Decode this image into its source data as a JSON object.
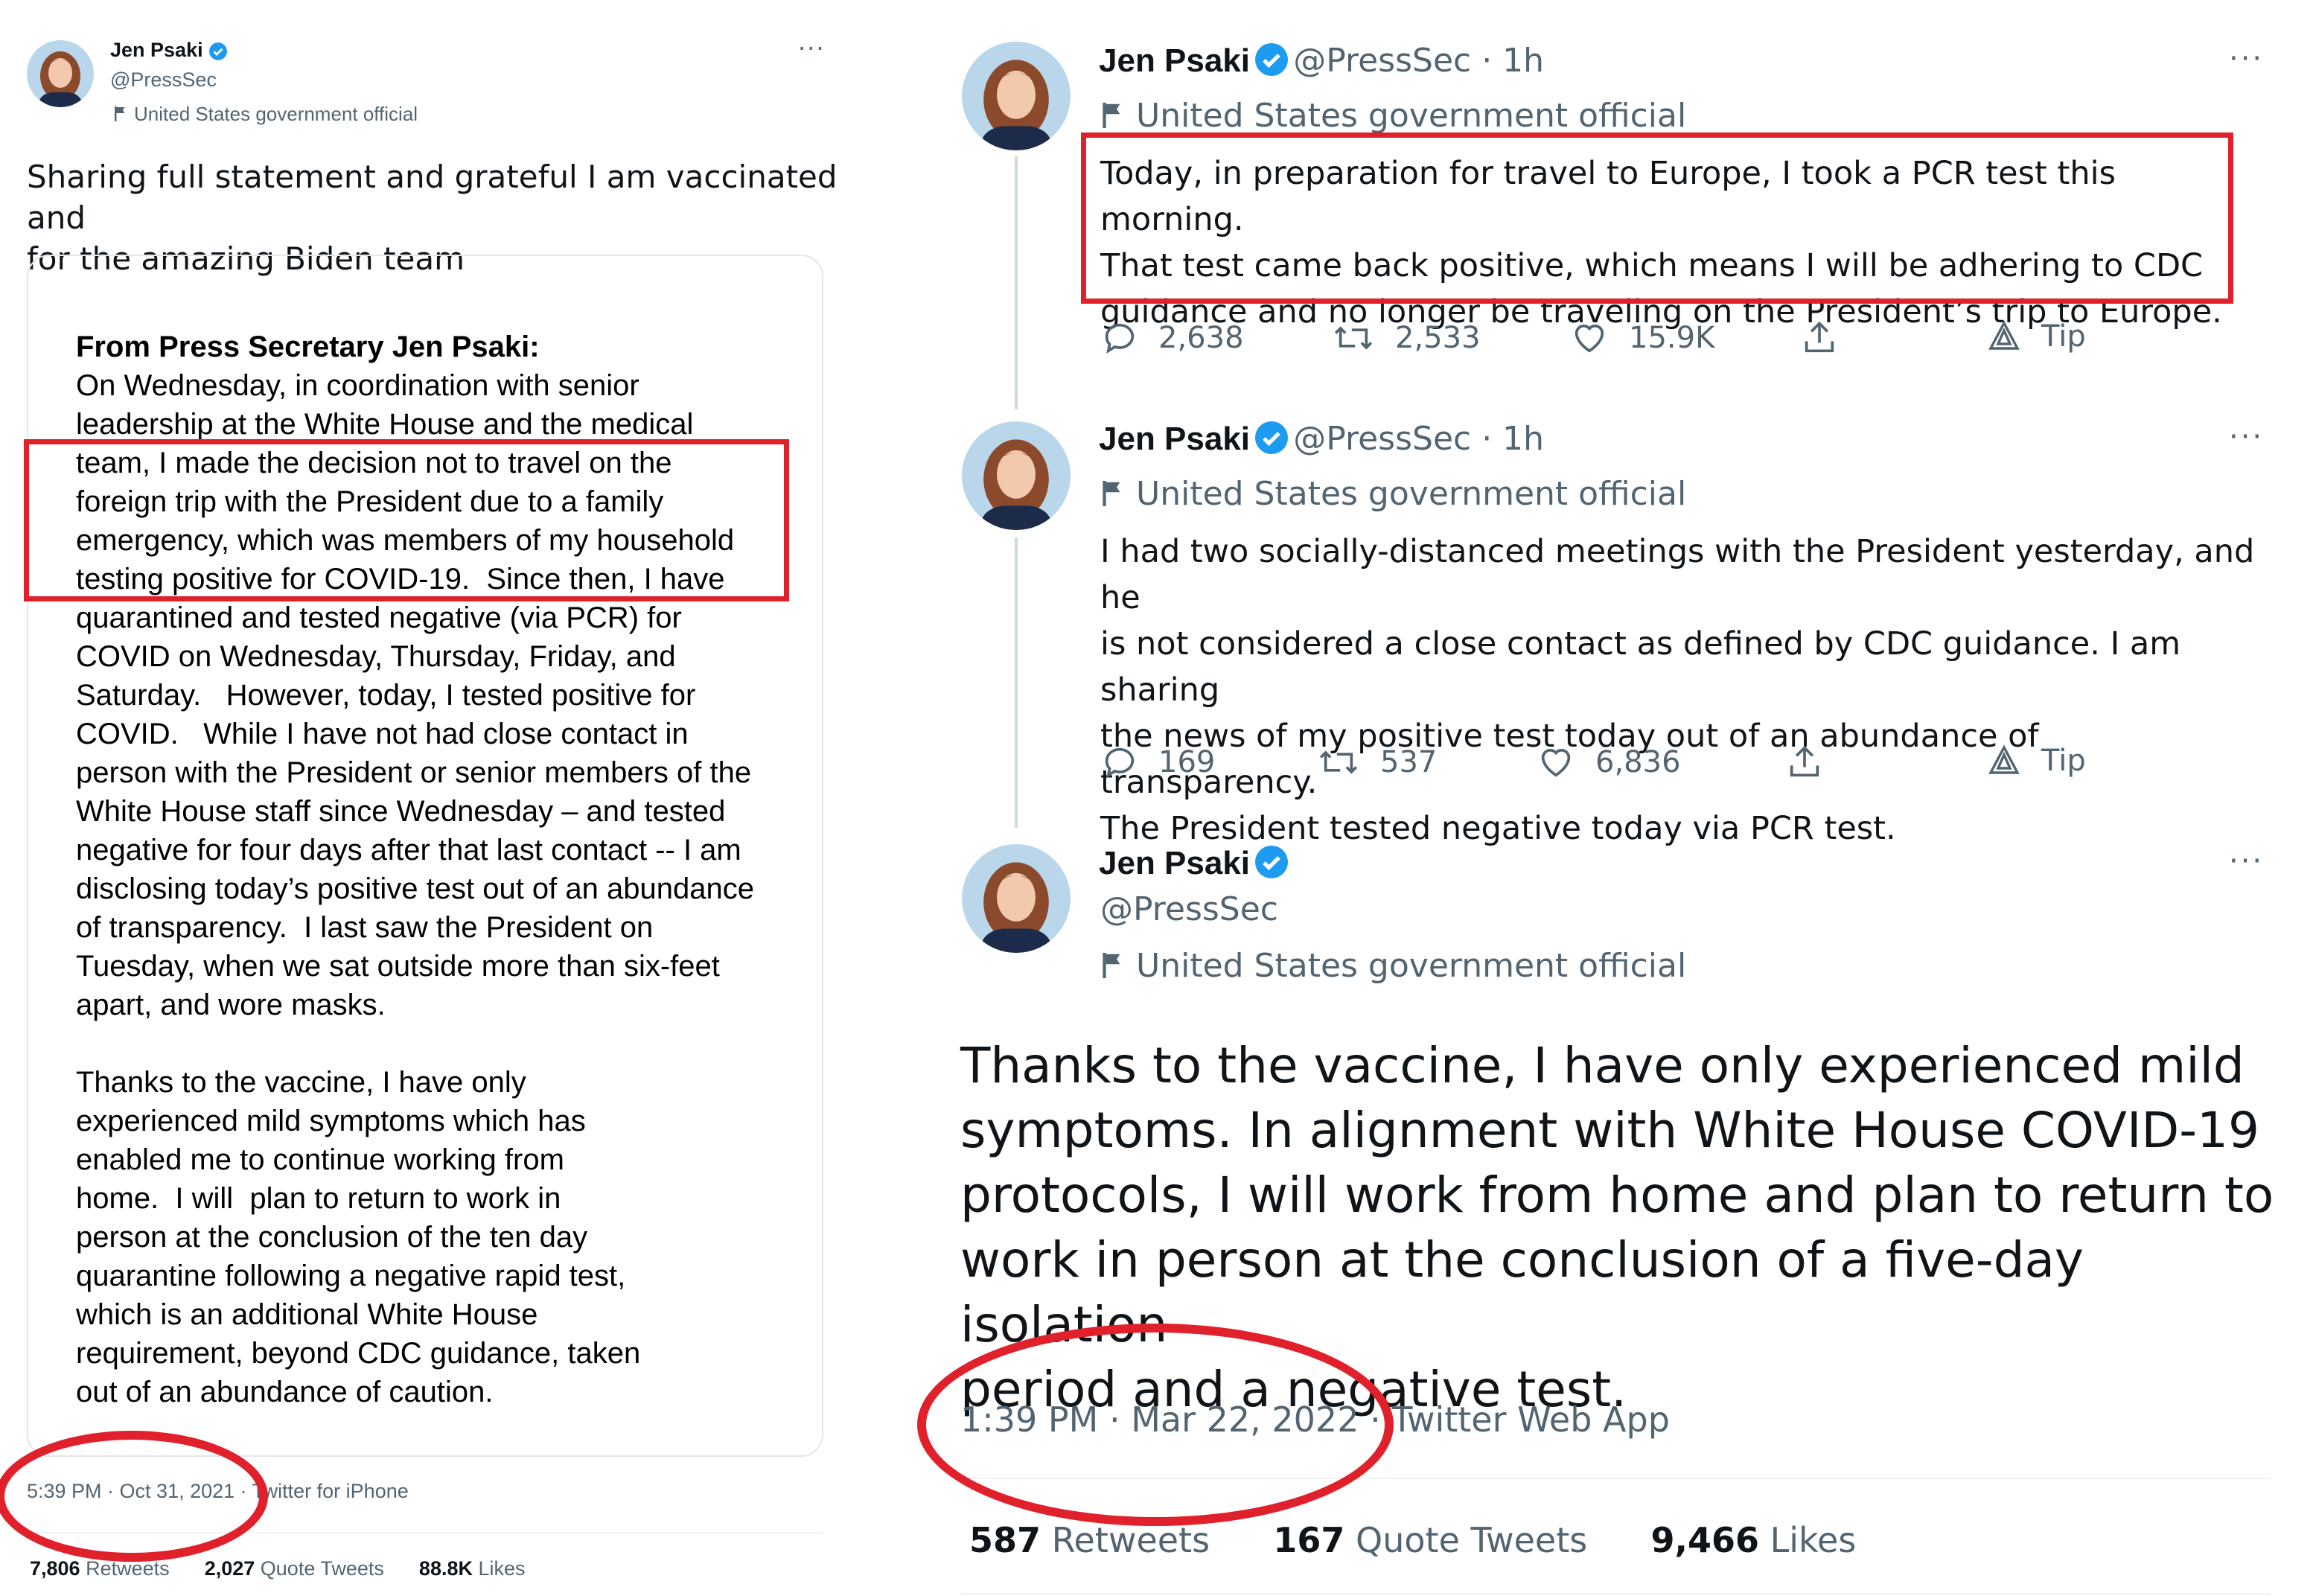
{
  "colors": {
    "verified_blue": "#1d9bf0",
    "annotation_red": "#e0202a",
    "muted": "#536471"
  },
  "left_tweet": {
    "author_name": "Jen Psaki",
    "handle": "@PressSec",
    "gov_label": "United States government official",
    "more_label": "···",
    "text_lines": [
      "Sharing full statement and grateful I am vaccinated and",
      "for the amazing Biden team"
    ],
    "statement": {
      "title": "From Press Secretary Jen Psaki:",
      "lines": [
        "On Wednesday, in coordination with senior",
        "leadership at the White House and the medical",
        "team, I made the decision not to travel on the",
        "foreign trip with the President due to a family",
        "emergency, which was members of my household",
        "testing positive for COVID-19.  Since then, I have",
        "quarantined and tested negative (via PCR) for",
        "COVID on Wednesday, Thursday, Friday, and",
        "Saturday.   However, today, I tested positive for",
        "COVID.   While I have not had close contact in",
        "person with the President or senior members of the",
        "White House staff since Wednesday – and tested",
        "negative for four days after that last contact -- I am",
        "disclosing today’s positive test out of an abundance",
        "of transparency.  I last saw the President on",
        "Tuesday, when we sat outside more than six-feet",
        "apart, and wore masks.",
        "",
        "Thanks to the vaccine, I have only",
        "experienced mild symptoms which has",
        "enabled me to continue working from",
        "home.  I will  plan to return to work in",
        "person at the conclusion of the ten day",
        "quarantine following a negative rapid test,",
        "which is an additional White House",
        "requirement, beyond CDC guidance, taken",
        "out of an abundance of caution."
      ]
    },
    "timestamp": "5:39 PM · Oct 31, 2021 · Twitter for iPhone",
    "stats": {
      "retweets": "7,806",
      "retweets_label": "Retweets",
      "quotes": "2,027",
      "quotes_label": "Quote Tweets",
      "likes": "88.8K",
      "likes_label": "Likes"
    }
  },
  "right_thread": {
    "tweets": [
      {
        "author_name": "Jen Psaki",
        "handle_time": "@PressSec · 1h",
        "gov_label": "United States government official",
        "body_lines": [
          "Today, in preparation for travel to Europe, I took a PCR test this morning.",
          "That test came back positive, which means I will be adhering to CDC",
          "guidance and no longer be traveling on the President’s trip to Europe."
        ],
        "replies": "2,638",
        "retweets": "2,533",
        "likes": "15.9K",
        "tip_label": "Tip"
      },
      {
        "author_name": "Jen Psaki",
        "handle_time": "@PressSec · 1h",
        "gov_label": "United States government official",
        "body_lines": [
          "I had two socially-distanced meetings with the President yesterday, and he",
          "is not considered a close contact as defined by CDC guidance. I am sharing",
          "the news of my positive test today out of an abundance of transparency.",
          "The President tested negative today via PCR test."
        ],
        "replies": "169",
        "retweets": "537",
        "likes": "6,836",
        "tip_label": "Tip"
      }
    ],
    "main_tweet": {
      "author_name": "Jen Psaki",
      "handle": "@PressSec",
      "gov_label": "United States government official",
      "text_lines": [
        "Thanks to the vaccine, I have only experienced mild",
        "symptoms. In alignment with White House COVID-19",
        "protocols, I will work from home and plan to return to",
        "work in person at the conclusion of a five-day isolation",
        "period and a negative test."
      ],
      "timestamp": "1:39 PM · Mar 22, 2022 · Twitter Web App",
      "stats": {
        "retweets": "587",
        "retweets_label": "Retweets",
        "quotes": "167",
        "quotes_label": "Quote Tweets",
        "likes": "9,466",
        "likes_label": "Likes"
      }
    },
    "more_label": "···"
  }
}
